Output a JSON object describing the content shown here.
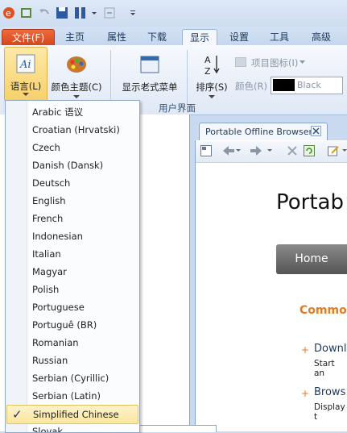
{
  "quick_access": {
    "icons": [
      "app-logo-icon",
      "refresh-icon",
      "undo-icon",
      "save-icon",
      "columns-icon",
      "dropdown-icon",
      "minimize-icon",
      "customize-icon"
    ]
  },
  "tabs": {
    "file": "文件(F)",
    "home": "主页",
    "properties": "属性",
    "download": "下载",
    "display": "显示",
    "settings": "设置",
    "tools": "工具",
    "advanced": "高级"
  },
  "ribbon": {
    "language": "语言(L)",
    "color_theme": "颜色主题(C)",
    "old_menu": "显示老式菜单",
    "sort": "排序(S)",
    "item_icon": "项目图标(I)",
    "color": "颜色(R)",
    "color_value": "Black",
    "group_label": "用户界面"
  },
  "document": {
    "tab_title": "Portable Offline Browser",
    "heading": "Portab",
    "home_button": "Home",
    "common": "Commo",
    "bullet1": "Downl",
    "bullet1_sub": "Start an",
    "bullet2": "Brows",
    "bullet2_sub": "Display t"
  },
  "menu": {
    "items": [
      {
        "label": "Arabic 语议",
        "selected": false
      },
      {
        "label": "Croatian (Hrvatski)",
        "selected": false
      },
      {
        "label": "Czech",
        "selected": false
      },
      {
        "label": "Danish (Dansk)",
        "selected": false
      },
      {
        "label": "Deutsch",
        "selected": false
      },
      {
        "label": "English",
        "selected": false
      },
      {
        "label": "French",
        "selected": false
      },
      {
        "label": "Indonesian",
        "selected": false
      },
      {
        "label": "Italian",
        "selected": false
      },
      {
        "label": "Magyar",
        "selected": false
      },
      {
        "label": "Polish",
        "selected": false
      },
      {
        "label": "Portuguese",
        "selected": false
      },
      {
        "label": "Portuguê (BR)",
        "selected": false
      },
      {
        "label": "Romanian",
        "selected": false
      },
      {
        "label": "Russian",
        "selected": false
      },
      {
        "label": "Serbian (Cyrillic)",
        "selected": false
      },
      {
        "label": "Serbian (Latin)",
        "selected": false
      },
      {
        "label": "Simplified Chinese",
        "selected": true
      },
      {
        "label": "Slovak",
        "selected": false
      }
    ]
  },
  "colors": {
    "accent_file_tab": "#e0532a",
    "selection": "#fbe69b",
    "common_orange": "#e8791d"
  }
}
